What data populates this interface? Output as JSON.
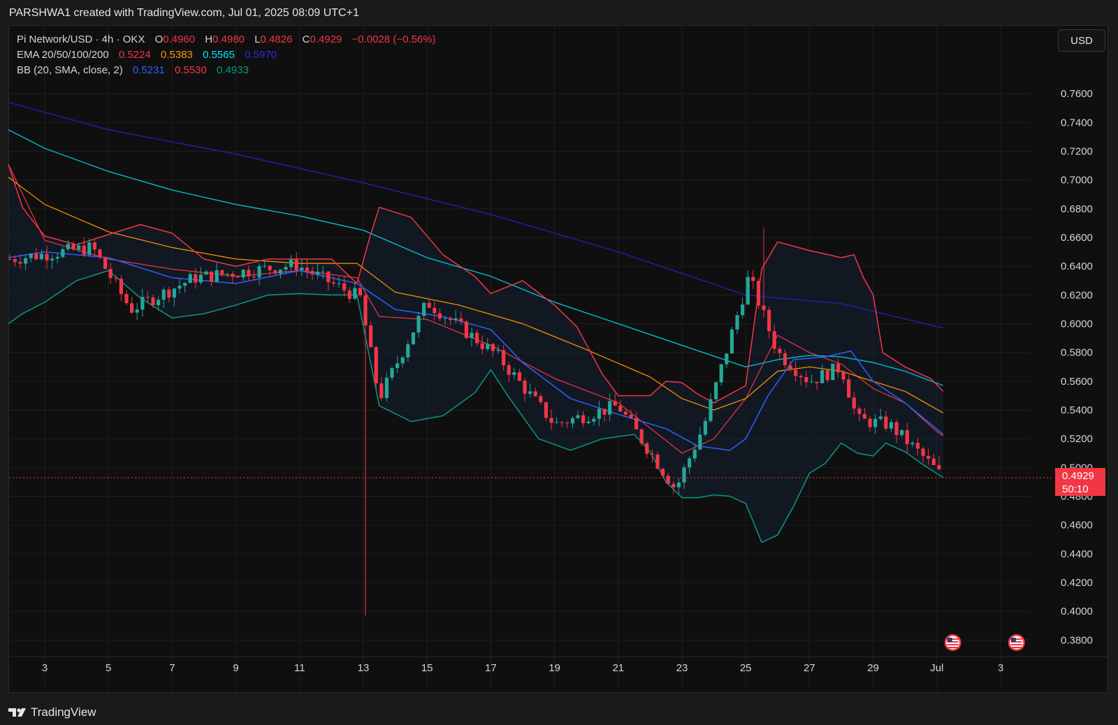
{
  "header": {
    "attribution": "PARSHWA1 created with TradingView.com, Jul 01, 2025 08:09 UTC+1"
  },
  "legend": {
    "symbol": "Pi Network/USD · 4h · OKX",
    "ohlc": {
      "o_label": "O",
      "o": "0.4960",
      "h_label": "H",
      "h": "0.4980",
      "l_label": "L",
      "l": "0.4826",
      "c_label": "C",
      "c": "0.4929",
      "change": "−0.0028 (−0.56%)"
    },
    "ema": {
      "label": "EMA 20/50/100/200",
      "v20": "0.5224",
      "v50": "0.5383",
      "v100": "0.5565",
      "v200": "0.5970"
    },
    "bb": {
      "label": "BB (20, SMA, close, 2)",
      "basis": "0.5231",
      "upper": "0.5530",
      "lower": "0.4933"
    }
  },
  "currency_button": "USD",
  "last_price": {
    "price": "0.4929",
    "countdown": "50:10"
  },
  "footer": {
    "brand": "TradingView"
  },
  "colors": {
    "up": "#26a69a",
    "down": "#f23645",
    "ema20": "#f23645",
    "ema50": "#ff9800",
    "ema100": "#00bcd4",
    "ema200": "#1e22aa",
    "bb_basis": "#2962ff",
    "bb_upper": "#f23645",
    "bb_lower": "#089981",
    "background": "#0f0f0f"
  },
  "chart_data": {
    "type": "candlestick",
    "timeframe": "4h",
    "ylim": [
      0.37,
      0.77
    ],
    "y_ticks": [
      "0.7600",
      "0.7400",
      "0.7200",
      "0.7000",
      "0.6800",
      "0.6600",
      "0.6400",
      "0.6200",
      "0.6000",
      "0.5800",
      "0.5600",
      "0.5400",
      "0.5200",
      "0.5000",
      "0.4800",
      "0.4600",
      "0.4400",
      "0.4200",
      "0.4000",
      "0.3800"
    ],
    "x_ticks": [
      {
        "label": "3",
        "day": 3
      },
      {
        "label": "5",
        "day": 5
      },
      {
        "label": "7",
        "day": 7
      },
      {
        "label": "9",
        "day": 9
      },
      {
        "label": "11",
        "day": 11
      },
      {
        "label": "13",
        "day": 13
      },
      {
        "label": "15",
        "day": 15
      },
      {
        "label": "17",
        "day": 17
      },
      {
        "label": "19",
        "day": 19
      },
      {
        "label": "21",
        "day": 21
      },
      {
        "label": "23",
        "day": 23
      },
      {
        "label": "25",
        "day": 25
      },
      {
        "label": "27",
        "day": 27
      },
      {
        "label": "29",
        "day": 29
      },
      {
        "label": "Jul",
        "day": 31
      },
      {
        "label": "3",
        "day": 33
      }
    ],
    "x_range_days": [
      1.86,
      34.7
    ],
    "last_price": 0.4929,
    "event_markers_days": [
      31.5,
      33.5
    ],
    "key_points": [
      {
        "day": 1.9,
        "close": 0.645
      },
      {
        "day": 4.5,
        "close": 0.653
      },
      {
        "day": 5.7,
        "close": 0.61
      },
      {
        "day": 7.7,
        "close": 0.632
      },
      {
        "day": 10.9,
        "close": 0.641
      },
      {
        "day": 12.9,
        "close": 0.618
      },
      {
        "day": 13.0,
        "low": 0.397
      },
      {
        "day": 13.5,
        "close": 0.548
      },
      {
        "day": 15.0,
        "close": 0.615
      },
      {
        "day": 17.2,
        "close": 0.578
      },
      {
        "day": 19.0,
        "close": 0.53
      },
      {
        "day": 21.0,
        "close": 0.543
      },
      {
        "day": 22.8,
        "close": 0.485
      },
      {
        "day": 23.7,
        "close": 0.53
      },
      {
        "day": 25.1,
        "close": 0.633
      },
      {
        "day": 25.5,
        "high": 0.667
      },
      {
        "day": 26.0,
        "close": 0.58
      },
      {
        "day": 27.0,
        "close": 0.56
      },
      {
        "day": 28.0,
        "close": 0.57
      },
      {
        "day": 28.5,
        "close": 0.533
      },
      {
        "day": 29.5,
        "close": 0.53
      },
      {
        "day": 30.5,
        "close": 0.509
      },
      {
        "day": 31.2,
        "close": 0.4929
      }
    ],
    "series": [
      {
        "name": "EMA 20",
        "points": [
          [
            1.86,
            0.711
          ],
          [
            3,
            0.658
          ],
          [
            5,
            0.645
          ],
          [
            7,
            0.638
          ],
          [
            9,
            0.633
          ],
          [
            11,
            0.637
          ],
          [
            12.8,
            0.632
          ],
          [
            13.5,
            0.605
          ],
          [
            15,
            0.603
          ],
          [
            17,
            0.585
          ],
          [
            19,
            0.562
          ],
          [
            21,
            0.545
          ],
          [
            23,
            0.51
          ],
          [
            24,
            0.52
          ],
          [
            25,
            0.548
          ],
          [
            26,
            0.592
          ],
          [
            27,
            0.58
          ],
          [
            28,
            0.572
          ],
          [
            29,
            0.555
          ],
          [
            30,
            0.545
          ],
          [
            31,
            0.525
          ],
          [
            31.2,
            0.522
          ]
        ]
      },
      {
        "name": "EMA 50",
        "points": [
          [
            1.86,
            0.702
          ],
          [
            3,
            0.683
          ],
          [
            5,
            0.664
          ],
          [
            7,
            0.653
          ],
          [
            9,
            0.645
          ],
          [
            11,
            0.642
          ],
          [
            12.8,
            0.642
          ],
          [
            14,
            0.622
          ],
          [
            16,
            0.613
          ],
          [
            18,
            0.6
          ],
          [
            20,
            0.582
          ],
          [
            22,
            0.563
          ],
          [
            23,
            0.548
          ],
          [
            24,
            0.54
          ],
          [
            25,
            0.548
          ],
          [
            26,
            0.567
          ],
          [
            27,
            0.57
          ],
          [
            28,
            0.567
          ],
          [
            29,
            0.56
          ],
          [
            30,
            0.553
          ],
          [
            31.2,
            0.538
          ]
        ]
      },
      {
        "name": "EMA 100",
        "points": [
          [
            1.86,
            0.735
          ],
          [
            3,
            0.722
          ],
          [
            5,
            0.706
          ],
          [
            7,
            0.693
          ],
          [
            9,
            0.683
          ],
          [
            11,
            0.675
          ],
          [
            13,
            0.665
          ],
          [
            15,
            0.646
          ],
          [
            17,
            0.633
          ],
          [
            19,
            0.615
          ],
          [
            21,
            0.6
          ],
          [
            23,
            0.585
          ],
          [
            25,
            0.57
          ],
          [
            26,
            0.575
          ],
          [
            27,
            0.578
          ],
          [
            28,
            0.577
          ],
          [
            29,
            0.573
          ],
          [
            30,
            0.567
          ],
          [
            31.2,
            0.557
          ]
        ]
      },
      {
        "name": "EMA 200",
        "points": [
          [
            1.86,
            0.754
          ],
          [
            5,
            0.735
          ],
          [
            9,
            0.718
          ],
          [
            13,
            0.698
          ],
          [
            17,
            0.676
          ],
          [
            21,
            0.65
          ],
          [
            25,
            0.62
          ],
          [
            28,
            0.614
          ],
          [
            31.2,
            0.597
          ]
        ]
      },
      {
        "name": "BB basis",
        "points": [
          [
            1.86,
            0.646
          ],
          [
            3,
            0.65
          ],
          [
            5,
            0.646
          ],
          [
            7,
            0.632
          ],
          [
            9,
            0.628
          ],
          [
            11,
            0.637
          ],
          [
            12.8,
            0.628
          ],
          [
            14,
            0.61
          ],
          [
            15.5,
            0.605
          ],
          [
            17,
            0.596
          ],
          [
            18,
            0.573
          ],
          [
            19.5,
            0.548
          ],
          [
            21,
            0.537
          ],
          [
            22.5,
            0.527
          ],
          [
            23.5,
            0.515
          ],
          [
            24.5,
            0.512
          ],
          [
            25,
            0.52
          ],
          [
            25.7,
            0.55
          ],
          [
            26.5,
            0.575
          ],
          [
            27.5,
            0.577
          ],
          [
            28.3,
            0.581
          ],
          [
            29,
            0.56
          ],
          [
            30,
            0.545
          ],
          [
            31.2,
            0.523
          ]
        ]
      },
      {
        "name": "BB upper",
        "points": [
          [
            1.86,
            0.711
          ],
          [
            2.3,
            0.681
          ],
          [
            3,
            0.661
          ],
          [
            4,
            0.655
          ],
          [
            5,
            0.662
          ],
          [
            6,
            0.669
          ],
          [
            7,
            0.663
          ],
          [
            8,
            0.645
          ],
          [
            9,
            0.64
          ],
          [
            10,
            0.645
          ],
          [
            11,
            0.645
          ],
          [
            12,
            0.645
          ],
          [
            12.8,
            0.628
          ],
          [
            13.2,
            0.66
          ],
          [
            13.5,
            0.681
          ],
          [
            14.5,
            0.674
          ],
          [
            15.5,
            0.648
          ],
          [
            16.5,
            0.633
          ],
          [
            17,
            0.621
          ],
          [
            18,
            0.63
          ],
          [
            19,
            0.613
          ],
          [
            19.7,
            0.598
          ],
          [
            20.5,
            0.565
          ],
          [
            21,
            0.55
          ],
          [
            22,
            0.55
          ],
          [
            22.5,
            0.56
          ],
          [
            23,
            0.559
          ],
          [
            23.5,
            0.551
          ],
          [
            24,
            0.545
          ],
          [
            25,
            0.557
          ],
          [
            25.5,
            0.638
          ],
          [
            26,
            0.657
          ],
          [
            27,
            0.651
          ],
          [
            28,
            0.646
          ],
          [
            28.4,
            0.648
          ],
          [
            28.7,
            0.632
          ],
          [
            29,
            0.62
          ],
          [
            29.3,
            0.58
          ],
          [
            30,
            0.57
          ],
          [
            30.8,
            0.562
          ],
          [
            31.2,
            0.553
          ]
        ]
      },
      {
        "name": "BB lower",
        "points": [
          [
            1.86,
            0.6
          ],
          [
            2.3,
            0.607
          ],
          [
            3,
            0.615
          ],
          [
            4,
            0.63
          ],
          [
            5,
            0.637
          ],
          [
            6,
            0.618
          ],
          [
            7,
            0.604
          ],
          [
            8,
            0.607
          ],
          [
            9,
            0.613
          ],
          [
            10,
            0.62
          ],
          [
            11,
            0.621
          ],
          [
            12,
            0.62
          ],
          [
            12.8,
            0.62
          ],
          [
            13.5,
            0.543
          ],
          [
            14.5,
            0.532
          ],
          [
            15.5,
            0.536
          ],
          [
            16.5,
            0.552
          ],
          [
            17,
            0.568
          ],
          [
            17.5,
            0.551
          ],
          [
            18.5,
            0.52
          ],
          [
            19.5,
            0.512
          ],
          [
            20.5,
            0.52
          ],
          [
            21.5,
            0.523
          ],
          [
            22,
            0.511
          ],
          [
            22.5,
            0.49
          ],
          [
            23,
            0.479
          ],
          [
            23.5,
            0.479
          ],
          [
            24,
            0.481
          ],
          [
            24.5,
            0.48
          ],
          [
            25,
            0.475
          ],
          [
            25.5,
            0.448
          ],
          [
            26,
            0.453
          ],
          [
            26.5,
            0.473
          ],
          [
            27,
            0.496
          ],
          [
            27.5,
            0.503
          ],
          [
            28,
            0.517
          ],
          [
            28.5,
            0.51
          ],
          [
            29,
            0.508
          ],
          [
            29.4,
            0.517
          ],
          [
            30,
            0.511
          ],
          [
            30.5,
            0.503
          ],
          [
            31.2,
            0.493
          ]
        ]
      }
    ]
  }
}
